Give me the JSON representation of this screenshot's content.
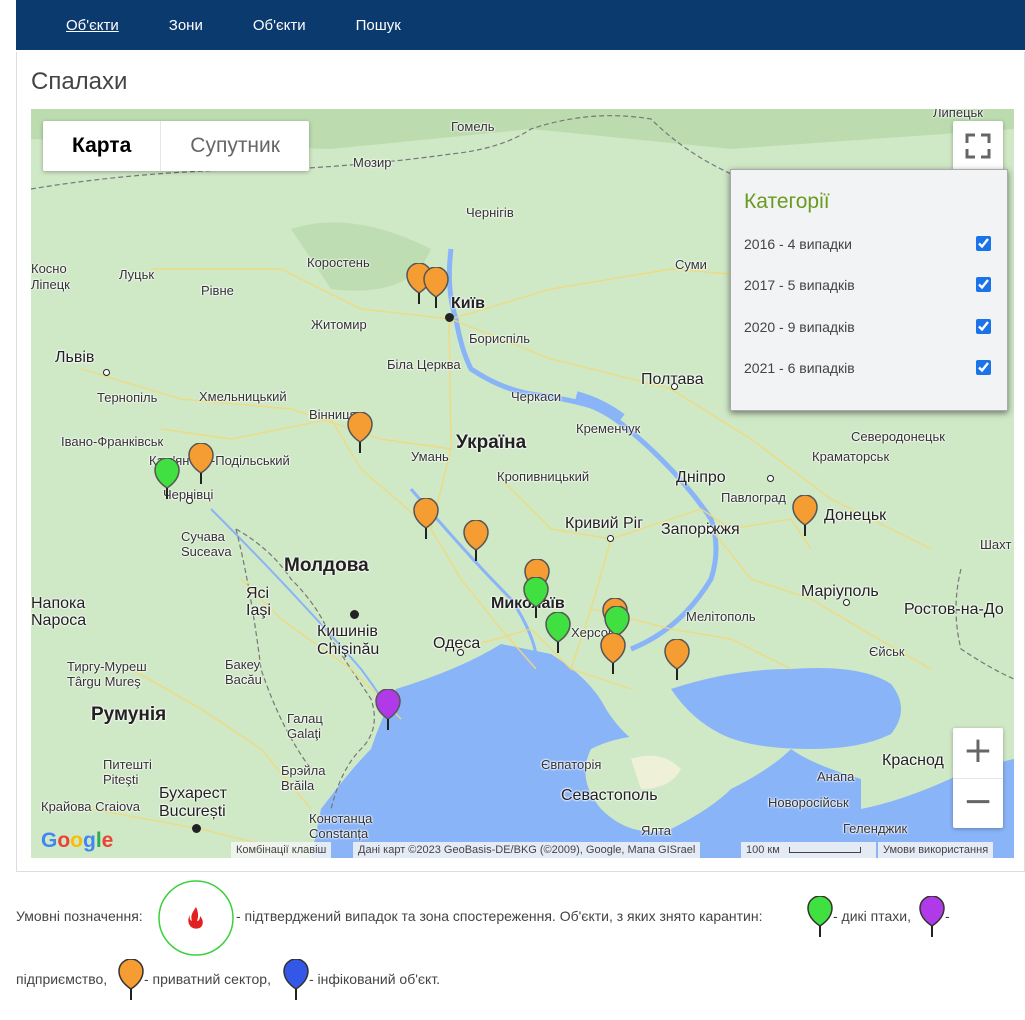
{
  "nav": {
    "items": [
      "Об'єкти",
      "Зони",
      "Об'єкти",
      "Пошук"
    ]
  },
  "page": {
    "title": "Спалахи"
  },
  "map": {
    "type_buttons": [
      "Карта",
      "Супутник"
    ],
    "country_labels": [
      "Україна",
      "Молдова",
      "Румунія"
    ],
    "cities": [
      "Гомель",
      "Мозир",
      "Чернігів",
      "Коростень",
      "Київ",
      "Бориспіль",
      "Житомир",
      "Луцьк",
      "Рівне",
      "Суми",
      "Біла Церква",
      "Львів",
      "Тернопіль",
      "Хмельницький",
      "Вінниця",
      "Черкаси",
      "Полтава",
      "Кременчук",
      "Івано-Франківськ",
      "Кам'янець-Подільський",
      "Умань",
      "Чернівці",
      "Кропивницький",
      "Дніпро",
      "Павлоград",
      "Донецьк",
      "Сучава Suceava",
      "Кривий Ріг",
      "Запоріжжя",
      "Миколаїв",
      "Херсон",
      "Мелітополь",
      "Маріуполь",
      "Ростов-на-До",
      "Ясі Iaşi",
      "Кишинів Chişinău",
      "Одеса",
      "Бакеу Bacău",
      "Тиргу-Муреш Târgu Mureş",
      "Галац Galaţi",
      "Брэйла Brăila",
      "Євпаторія",
      "Севастополь",
      "Ялта",
      "Питешті Piteşti",
      "Бухарест București",
      "Крайова Craiova",
      "Констанца Constanța",
      "Анапа",
      "Новоросійськ",
      "Геленджик",
      "Краснод",
      "Єйськ",
      "Краматорськ",
      "Северодонецьк",
      "Шахт",
      "Липецьк",
      "Косно",
      "Ліпецк",
      "Напока",
      "Napoca"
    ],
    "attribution": {
      "shortcuts": "Комбінації клавіш",
      "data": "Дані карт ©2023 GeoBasis-DE/BKG (©2009), Google, Мапа GISrael",
      "scale": "100 км",
      "terms": "Умови використання"
    },
    "google_logo": "Google"
  },
  "categories": {
    "title": "Категорії",
    "items": [
      {
        "label": "2016 - 4 випадки",
        "checked": true
      },
      {
        "label": "2017 - 5 випадків",
        "checked": true
      },
      {
        "label": "2020 - 9 випадків",
        "checked": true
      },
      {
        "label": "2021 - 6 випадків",
        "checked": true
      }
    ]
  },
  "legend": {
    "prefix": "Умовні позначення:",
    "confirmed": "- підтверджений випадок та зона спостереження. Об'єкти, з яких знято карантин:",
    "wild_birds": "- дикі птахи,",
    "enterprise_dash": "-",
    "enterprise": "підприємство,",
    "private": "- приватний сектор,",
    "infected": "- інфікований об'єкт."
  },
  "colors": {
    "orange": "#f59d33",
    "green": "#40e040",
    "purple": "#b03ae8",
    "blue": "#3358e8",
    "nav_bg": "#0b3a6e",
    "sea": "#8ab4f8"
  }
}
